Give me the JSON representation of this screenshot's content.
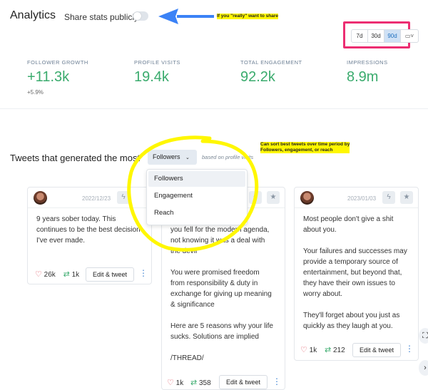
{
  "header": {
    "title": "Analytics",
    "share_label": "Share stats publicly",
    "share_enabled": false
  },
  "annotations": {
    "arrow_note": "If you \"really\" want to share",
    "sort_note": "Can sort best tweets over time period by\nFollowers, engagement, or reach",
    "arrow_color": "#3b82f6",
    "highlight_color": "#fff700",
    "box_color": "#ec2e72"
  },
  "range": {
    "options": [
      "7d",
      "30d",
      "90d"
    ],
    "selected": "90d",
    "calendar_icon": "calendar-icon"
  },
  "stats": [
    {
      "label": "FOLLOWER GROWTH",
      "value": "+11.3k",
      "sub": "+5.9%"
    },
    {
      "label": "PROFILE VISITS",
      "value": "19.4k",
      "sub": ""
    },
    {
      "label": "TOTAL ENGAGEMENT",
      "value": "92.2k",
      "sub": ""
    },
    {
      "label": "IMPRESSIONS",
      "value": "8.9m",
      "sub": ""
    }
  ],
  "tweets_section": {
    "title": "Tweets that generated the most",
    "sort_selected": "Followers",
    "based_on": "based on profile visits",
    "sort_options": [
      "Followers",
      "Engagement",
      "Reach"
    ]
  },
  "tweets": [
    {
      "date": "2022/12/23",
      "text": "9 years sober today.\n\nThis continues to be the best decision I've ever made.",
      "likes": "26k",
      "retweets": "1k",
      "edit_label": "Edit & tweet"
    },
    {
      "date": "",
      "text": "cause\nyou fell for the modern agenda,\nnot knowing it was a deal with\nthe devil\n\nYou were promised freedom\nfrom responsibility & duty in\nexchange for giving up meaning\n& significance\n\nHere are 5 reasons why your life\nsucks. Solutions are implied\n\n/THREAD/",
      "likes": "1k",
      "retweets": "358",
      "edit_label": "Edit & tweet"
    },
    {
      "date": "2023/01/03",
      "text": "Most people don't give a shit\nabout you.\n\nYour failures and successes may\nprovide a temporary source of\nentertainment, but beyond that,\nthey have their own issues to\nworry about.\n\nThey'll forget about you just as\nquickly as they laugh at you.",
      "likes": "1k",
      "retweets": "212",
      "edit_label": "Edit & tweet"
    }
  ]
}
